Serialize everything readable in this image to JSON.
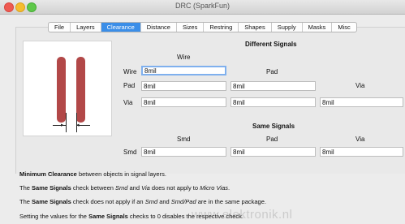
{
  "window": {
    "title": "DRC (SparkFun)"
  },
  "tabs": [
    {
      "label": "File",
      "active": false
    },
    {
      "label": "Layers",
      "active": false
    },
    {
      "label": "Clearance",
      "active": true
    },
    {
      "label": "Distance",
      "active": false
    },
    {
      "label": "Sizes",
      "active": false
    },
    {
      "label": "Restring",
      "active": false
    },
    {
      "label": "Shapes",
      "active": false
    },
    {
      "label": "Supply",
      "active": false
    },
    {
      "label": "Masks",
      "active": false
    },
    {
      "label": "Misc",
      "active": false
    }
  ],
  "different_signals": {
    "heading": "Different Signals",
    "col_wire": "Wire",
    "col_pad": "Pad",
    "col_via": "Via",
    "row_wire_label": "Wire",
    "row_pad_label": "Pad",
    "row_via_label": "Via",
    "wire_wire": "8mil",
    "pad_wire": "8mil",
    "pad_pad": "8mil",
    "via_wire": "8mil",
    "via_pad": "8mil",
    "via_via": "8mil"
  },
  "same_signals": {
    "heading": "Same Signals",
    "col_smd": "Smd",
    "col_pad": "Pad",
    "col_via": "Via",
    "row_label": "Smd",
    "smd_smd": "8mil",
    "smd_pad": "8mil",
    "smd_via": "8mil"
  },
  "notes": {
    "line1_bold": "Minimum Clearance",
    "line1_rest": " between objects in signal layers.",
    "line2_a": "The ",
    "line2_bold": "Same Signals",
    "line2_b": " check between ",
    "line2_i1": "Smd",
    "line2_c": " and ",
    "line2_i2": "Via",
    "line2_d": " does not apply to ",
    "line2_i3": "Micro Vias",
    "line2_e": ".",
    "line3_a": "The ",
    "line3_bold": "Same Signals",
    "line3_b": " check does not apply if an ",
    "line3_i1": "Smd",
    "line3_c": " and ",
    "line3_i2": "Smd/Pad",
    "line3_d": " are in the same package.",
    "line4_a": "Setting the values for the ",
    "line4_bold": "Same Signals",
    "line4_b": " checks to 0 disables the respective check."
  },
  "watermark": "www.elektronik.nl",
  "colors": {
    "accent": "#3b8ee8",
    "pad": "#b24848",
    "focus": "#7fb0ee"
  }
}
